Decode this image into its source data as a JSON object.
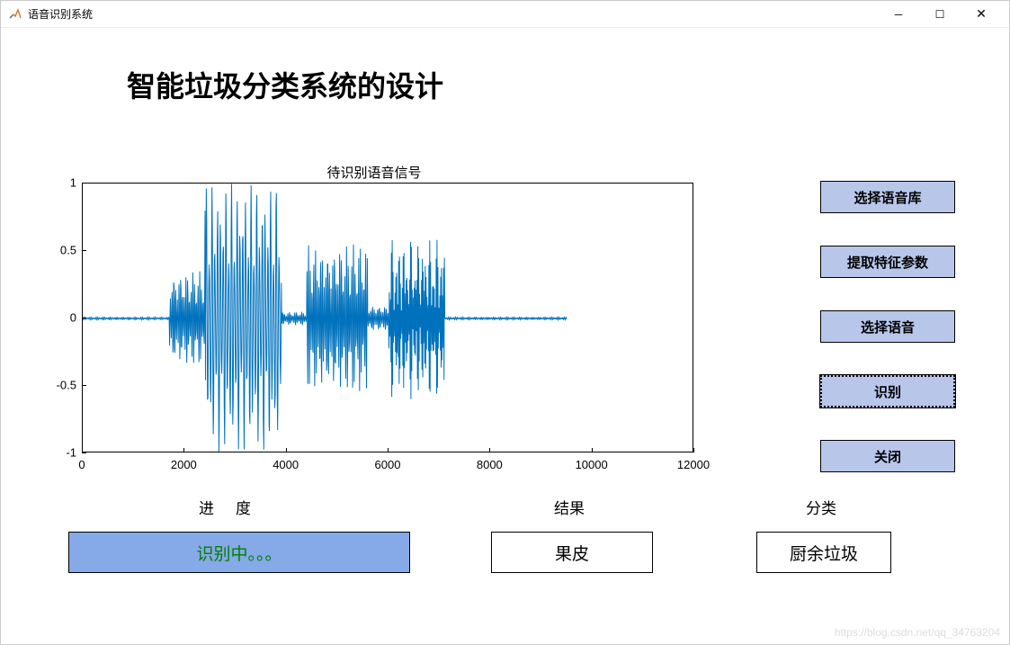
{
  "window": {
    "title": "语音识别系统"
  },
  "header": {
    "main_title": "智能垃圾分类系统的设计"
  },
  "buttons": {
    "select_lib": "选择语音库",
    "extract": "提取特征参数",
    "select_audio": "选择语音",
    "recognize": "识别",
    "close": "关闭"
  },
  "labels": {
    "progress": "进度",
    "result": "结果",
    "category": "分类"
  },
  "values": {
    "progress_text": "识别中。。。",
    "result_text": "果皮",
    "category_text": "厨余垃圾"
  },
  "watermark": "https://blog.csdn.net/qq_34763204",
  "chart_data": {
    "type": "line",
    "title": "待识别语音信号",
    "xlabel": "",
    "ylabel": "",
    "xlim": [
      0,
      12000
    ],
    "ylim": [
      -1,
      1
    ],
    "x_ticks": [
      0,
      2000,
      4000,
      6000,
      8000,
      10000,
      12000
    ],
    "y_ticks": [
      -1,
      -0.5,
      0,
      0.5,
      1
    ],
    "series": [
      {
        "name": "audio",
        "color": "#0072BD",
        "segments": [
          {
            "range": [
              0,
              1700
            ],
            "amplitude": 0.01,
            "description": "silence"
          },
          {
            "range": [
              1700,
              2400
            ],
            "amplitude": 0.35,
            "description": "onset burst"
          },
          {
            "range": [
              2400,
              3900
            ],
            "amplitude": 1.0,
            "description": "main dense burst, clipped at ±1"
          },
          {
            "range": [
              3900,
              4400
            ],
            "amplitude": 0.05,
            "description": "low gap"
          },
          {
            "range": [
              4400,
              5600
            ],
            "amplitude": 0.55,
            "description": "second burst"
          },
          {
            "range": [
              5600,
              6000
            ],
            "amplitude": 0.1,
            "description": "decay"
          },
          {
            "range": [
              6000,
              7100
            ],
            "amplitude": 0.6,
            "description": "third oscillatory burst"
          },
          {
            "range": [
              7100,
              9500
            ],
            "amplitude": 0.01,
            "description": "trailing silence baseline"
          },
          {
            "range": [
              9500,
              12000
            ],
            "amplitude": 0,
            "description": "no data drawn"
          }
        ]
      }
    ]
  }
}
